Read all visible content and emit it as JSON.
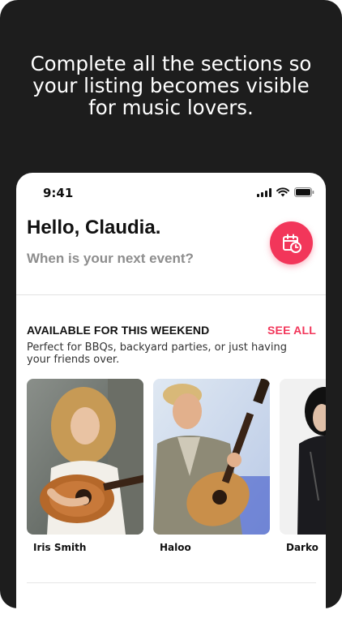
{
  "promo": {
    "headline": "Complete all the sections so your listing becomes visible for music lovers."
  },
  "status_bar": {
    "time": "9:41"
  },
  "header": {
    "greeting": "Hello, Claudia.",
    "subtitle": "When is your next event?",
    "calendar_icon": "calendar-clock-icon"
  },
  "section": {
    "title": "AVAILABLE FOR THIS WEEKEND",
    "see_all": "SEE ALL",
    "description": "Perfect for BBQs, backyard parties, or just having your friends over."
  },
  "artists": [
    {
      "name": "Iris Smith"
    },
    {
      "name": "Haloo"
    },
    {
      "name": "Darko"
    }
  ],
  "colors": {
    "accent": "#f2365a",
    "dark_background": "#1d1d1d"
  }
}
